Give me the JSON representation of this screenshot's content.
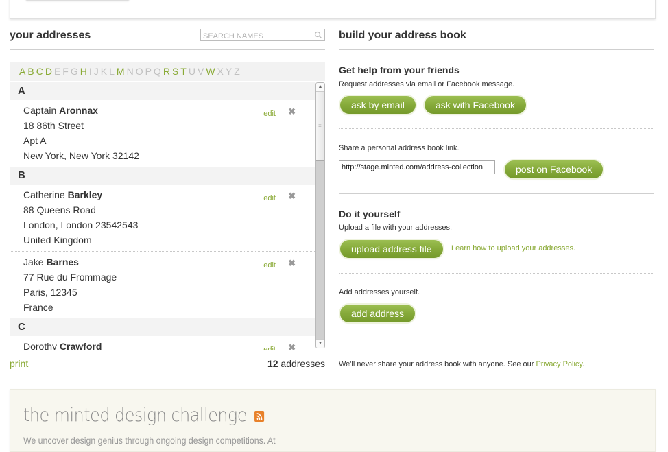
{
  "left": {
    "title": "your addresses",
    "search_placeholder": "SEARCH NAMES",
    "alphabet": [
      {
        "letter": "A",
        "active": true
      },
      {
        "letter": "B",
        "active": true
      },
      {
        "letter": "C",
        "active": true
      },
      {
        "letter": "D",
        "active": true
      },
      {
        "letter": "E",
        "active": false
      },
      {
        "letter": "F",
        "active": false
      },
      {
        "letter": "G",
        "active": false
      },
      {
        "letter": "H",
        "active": true
      },
      {
        "letter": "I",
        "active": false
      },
      {
        "letter": "J",
        "active": false
      },
      {
        "letter": "K",
        "active": false
      },
      {
        "letter": "L",
        "active": false
      },
      {
        "letter": "M",
        "active": true
      },
      {
        "letter": "N",
        "active": false
      },
      {
        "letter": "O",
        "active": false
      },
      {
        "letter": "P",
        "active": false
      },
      {
        "letter": "Q",
        "active": false
      },
      {
        "letter": "R",
        "active": true
      },
      {
        "letter": "S",
        "active": true
      },
      {
        "letter": "T",
        "active": true
      },
      {
        "letter": "U",
        "active": false
      },
      {
        "letter": "V",
        "active": false
      },
      {
        "letter": "W",
        "active": true
      },
      {
        "letter": "X",
        "active": false
      },
      {
        "letter": "Y",
        "active": false
      },
      {
        "letter": "Z",
        "active": false
      }
    ],
    "groups": [
      {
        "letter": "A",
        "entries": [
          {
            "first": "Captain",
            "last": "Aronnax",
            "lines": [
              "18 86th Street",
              "Apt A",
              "New York, New York 32142"
            ]
          }
        ]
      },
      {
        "letter": "B",
        "entries": [
          {
            "first": "Catherine",
            "last": "Barkley",
            "lines": [
              "88 Queens Road",
              "London, London 23542543",
              "United Kingdom"
            ]
          },
          {
            "first": "Jake",
            "last": "Barnes",
            "lines": [
              "77 Rue du Frommage",
              "Paris, 12345",
              "France"
            ]
          }
        ]
      },
      {
        "letter": "C",
        "entries": [
          {
            "first": "Dorothy",
            "last": "Crawford",
            "lines": []
          }
        ]
      }
    ],
    "edit_label": "edit",
    "delete_glyph": "✖",
    "print_label": "print",
    "count_number": "12",
    "count_suffix": " addresses"
  },
  "right": {
    "title": "build your address book",
    "friends_title": "Get help from your friends",
    "friends_desc": "Request addresses via email or Facebook message.",
    "ask_email_label": "ask by email",
    "ask_facebook_label": "ask with Facebook",
    "share_desc": "Share a personal address book link.",
    "share_url": "http://stage.minted.com/address-collection",
    "post_facebook_label": "post on Facebook",
    "diy_title": "Do it yourself",
    "upload_desc": "Upload a file with your addresses.",
    "upload_label": "upload address file",
    "learn_link": "Learn how to upload your addresses.",
    "add_desc": "Add addresses yourself.",
    "add_label": "add address",
    "privacy_text": "We'll never share your address book with anyone. See our ",
    "privacy_link": "Privacy Policy",
    "privacy_end": "."
  },
  "bottom": {
    "title": "the minted design challenge",
    "rss_icon": "rss-icon",
    "text": "We uncover design genius through ongoing design competitions. At"
  },
  "colors": {
    "accent_green": "#8aaa36",
    "button_green": "#86aa3a",
    "rss_orange": "#e8812a"
  }
}
